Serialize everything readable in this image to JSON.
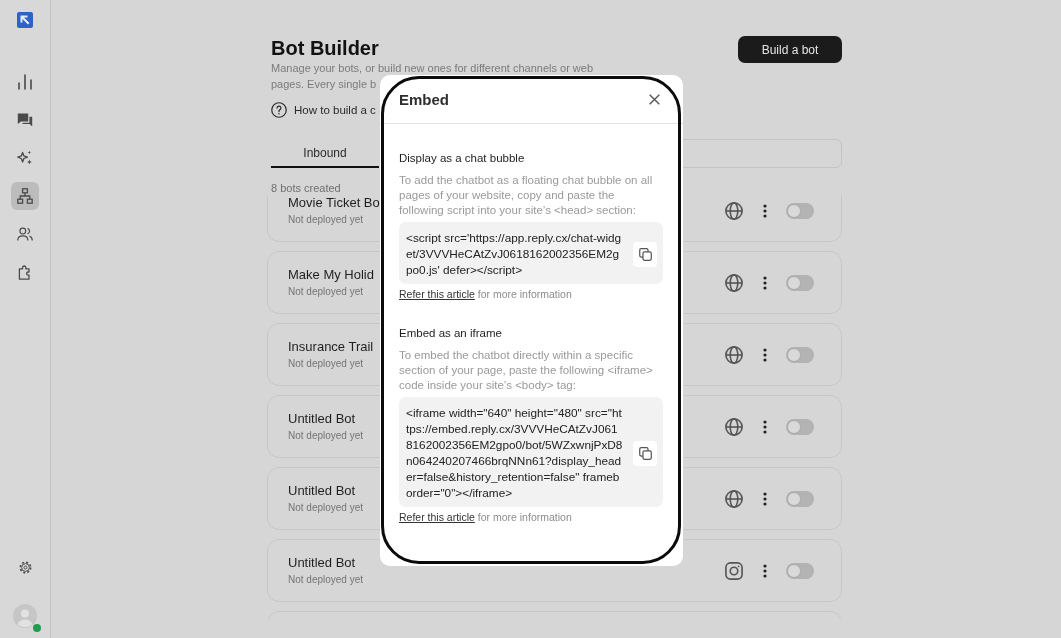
{
  "sidebar": {
    "items": [
      {
        "selected": false
      },
      {
        "selected": false
      },
      {
        "selected": false
      },
      {
        "selected": true
      },
      {
        "selected": false
      },
      {
        "selected": false
      }
    ],
    "user": {
      "online": true
    }
  },
  "header": {
    "title": "Bot Builder",
    "description": "Manage your bots, or build new ones for different channels or web pages. Every single b",
    "help_link": "How to build a c",
    "button": "Build a bot"
  },
  "tabs": [
    {
      "label": "Inbound",
      "selected": true
    }
  ],
  "bot_count": "8 bots created",
  "bots": [
    {
      "name": "Movie Ticket Bo",
      "status": "Not deployed yet",
      "kind": "globe",
      "on": false
    },
    {
      "name": "Make My Holid",
      "status": "Not deployed yet",
      "kind": "globe",
      "on": false
    },
    {
      "name": "Insurance Trail",
      "status": "Not deployed yet",
      "kind": "globe",
      "on": false
    },
    {
      "name": "Untitled Bot",
      "status": "Not deployed yet",
      "kind": "globe",
      "on": false
    },
    {
      "name": "Untitled Bot",
      "status": "Not deployed yet",
      "kind": "globe",
      "on": false
    },
    {
      "name": "Untitled Bot",
      "status": "Not deployed yet",
      "kind": "camera",
      "on": false
    }
  ],
  "dialog": {
    "title": "Embed",
    "sections": [
      {
        "heading": "Display as a chat bubble",
        "description": "To add the chatbot as a floating chat bubble on all pages of your website, copy and paste the following script into your site’s <head> section:",
        "code": "<script src='https://app.reply.cx/chat-widget/3VVVHeCAtZvJ0618162002356EM2gpo0.js' defer></script>",
        "link": "Refer this article",
        "note": "for more information"
      },
      {
        "heading": "Embed as an iframe",
        "description": "To embed the chatbot directly within a specific section of your page, paste the following <iframe> code inside your site’s <body> tag:",
        "code": "<iframe width=\"640\" height=\"480\" src=\"https://embed.reply.cx/3VVVHeCAtZvJ0618162002356EM2gpo0/bot/5WZxwnjPxD8n064240207466brqNNn61?display_header=false&history_retention=false\" frameborder=\"0\"></iframe>",
        "link": "Refer this article",
        "note": "for more information"
      }
    ]
  }
}
